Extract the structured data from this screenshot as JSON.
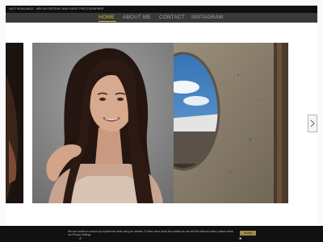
{
  "topbar": {
    "text": "KATY ROWLANDS - WELSH PORTRAIT AND EVENT PHOTOGRAPHER"
  },
  "nav": {
    "items": [
      {
        "label": "HOME",
        "active": true
      },
      {
        "label": "ABOUT ME"
      },
      {
        "label": "CONTACT"
      },
      {
        "label": "INSTAGRAM"
      }
    ]
  },
  "slider": {
    "slides": [
      {
        "subject": "dark portrait crop"
      },
      {
        "subject": "portrait of a young woman with long dark hair"
      },
      {
        "subject": "circular concrete sculpture with sky view"
      }
    ],
    "next_icon": "chevron-right-icon"
  },
  "cookie": {
    "text": "We use cookies to ensure you experience while using our website. To learn more about the cookies we use and the data we collect, please check our Privacy Settings",
    "accept_label": "Accept",
    "check_glyph": "✔",
    "decline_glyph": "✖"
  },
  "colors": {
    "accent": "#d9b64c",
    "nav_bg": "#3a3a3a",
    "topbar_bg": "#101010",
    "cookie_bg": "#111111"
  }
}
